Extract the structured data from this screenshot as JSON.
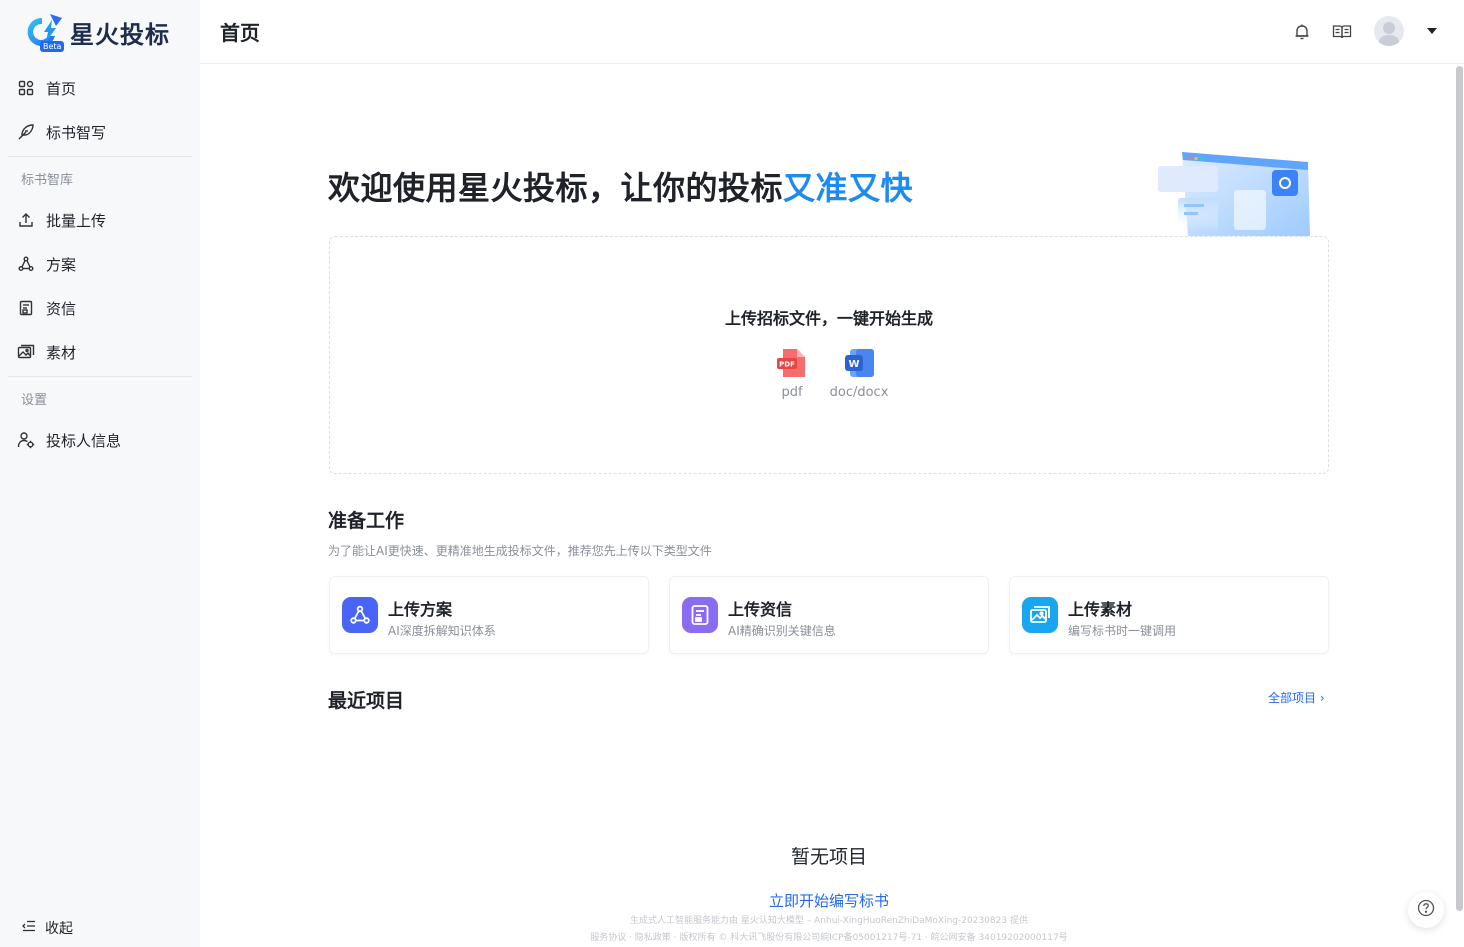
{
  "brand": {
    "name": "星火投标",
    "badge": "Beta"
  },
  "sidebar": {
    "items_top": [
      {
        "label": "首页",
        "icon": "grid-icon"
      },
      {
        "label": "标书智写",
        "icon": "quill-icon"
      }
    ],
    "group_library": "标书智库",
    "items_library": [
      {
        "label": "批量上传",
        "icon": "upload-icon"
      },
      {
        "label": "方案",
        "icon": "network-icon"
      },
      {
        "label": "资信",
        "icon": "certificate-icon"
      },
      {
        "label": "素材",
        "icon": "images-icon"
      }
    ],
    "group_settings": "设置",
    "items_settings": [
      {
        "label": "投标人信息",
        "icon": "user-settings-icon"
      }
    ],
    "collapse_label": "收起"
  },
  "header": {
    "title": "首页"
  },
  "welcome": {
    "prefix": "欢迎使用星火投标，让你的投标",
    "highlight": "又准又快",
    "highlight_color": "#1d8bf0"
  },
  "upload": {
    "title": "上传招标文件，一键开始生成",
    "types": [
      {
        "label": "pdf",
        "icon": "pdf-file-icon",
        "badge": "PDF"
      },
      {
        "label": "doc/docx",
        "icon": "word-file-icon",
        "badge": "W"
      }
    ]
  },
  "prep": {
    "title": "准备工作",
    "subtitle": "为了能让AI更快速、更精准地生成投标文件，推荐您先上传以下类型文件",
    "cards": [
      {
        "title": "上传方案",
        "desc": "AI深度拆解知识体系",
        "icon": "network-icon",
        "color": "#4a64f5"
      },
      {
        "title": "上传资信",
        "desc": "AI精确识别关键信息",
        "icon": "certificate-icon",
        "color": "#8a6cf0"
      },
      {
        "title": "上传素材",
        "desc": "编写标书时一键调用",
        "icon": "images-icon",
        "color": "#1aa5f0"
      }
    ]
  },
  "recent": {
    "title": "最近项目",
    "all_link": "全部项目",
    "empty_text": "暂无项目",
    "start_link": "立即开始编写标书"
  },
  "footer": {
    "line1": "生成式人工智能服务能力由 星火认知大模型 – Anhui-XingHuoRenZhiDaMoXing-20230823 提供",
    "line2": "服务协议 · 隐私政策 · 版权所有 © 科大讯飞股份有限公司皖ICP备05001217号-71 · 皖公网安备 34019202000117号"
  }
}
